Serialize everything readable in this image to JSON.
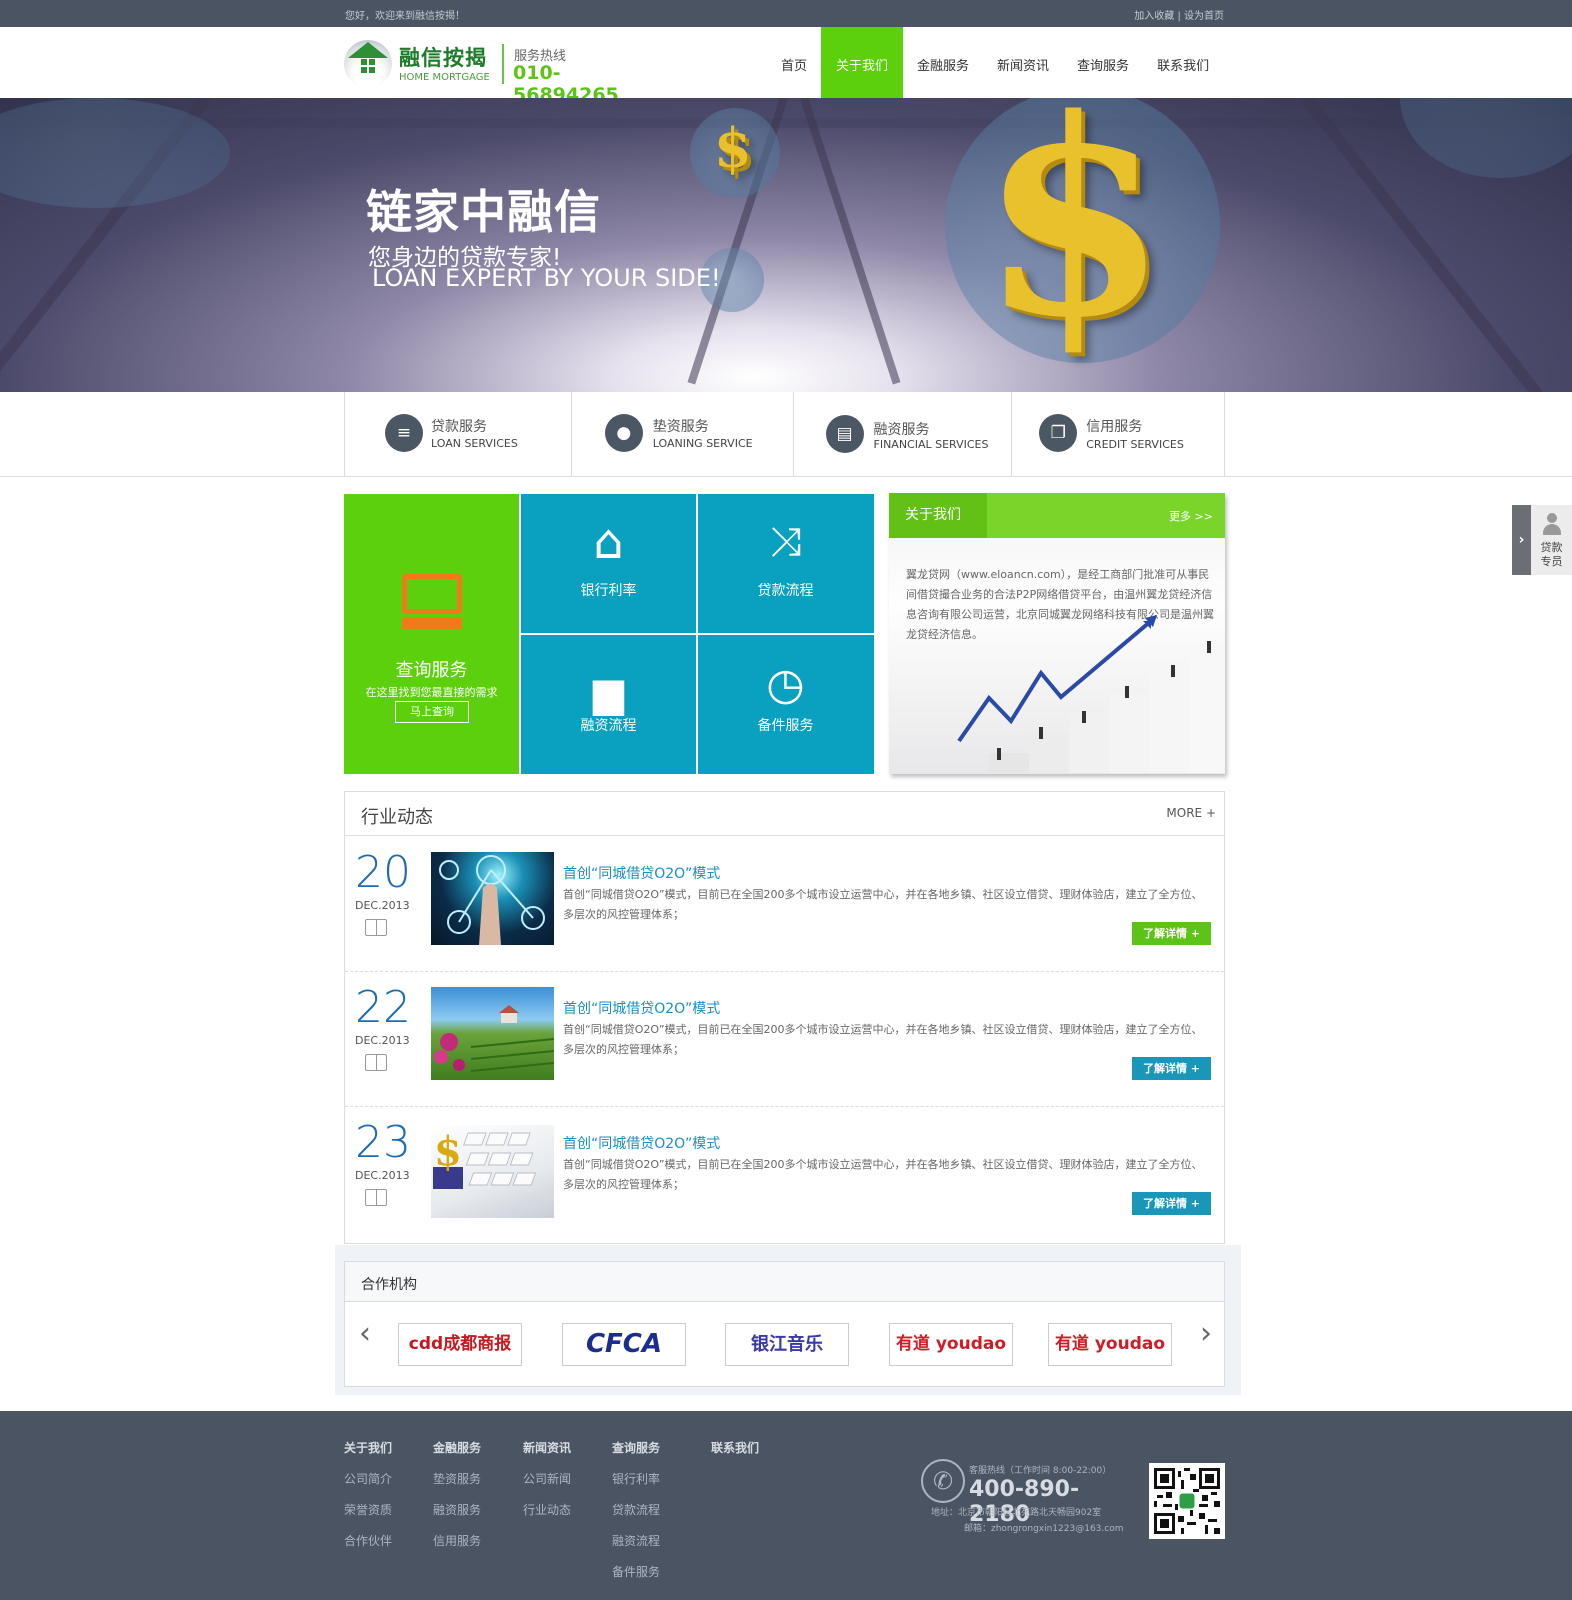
{
  "topbar": {
    "welcome": "您好，欢迎来到融信按揭！",
    "links": "加入收藏 | 设为首页"
  },
  "header": {
    "logo_cn": "融信按揭",
    "logo_en": "HOME MORTGAGE",
    "hotline_label": "服务热线",
    "hotline": "010-56894265"
  },
  "nav": [
    "首页",
    "关于我们",
    "金融服务",
    "新闻资讯",
    "查询服务",
    "联系我们"
  ],
  "nav_active": "关于我们",
  "banner": {
    "title": "链家中融信",
    "subtitle": "您身边的贷款专家!",
    "subtitle_en": "LOAN EXPERT BY YOUR SIDE!",
    "symbol": "$"
  },
  "services": [
    {
      "cn": "贷款服务",
      "en": "LOAN SERVICES",
      "icon": "coins-icon"
    },
    {
      "cn": "垫资服务",
      "en": "LOANING SERVICE",
      "icon": "user-icon"
    },
    {
      "cn": "融资服务",
      "en": "FINANCIAL SERVICES",
      "icon": "briefcase-icon"
    },
    {
      "cn": "信用服务",
      "en": "CREDIT SERVICES",
      "icon": "cards-icon"
    }
  ],
  "query": {
    "title": "查询服务",
    "subtitle": "在这里找到您最直接的需求",
    "button": "马上查询"
  },
  "tiles": [
    {
      "label": "银行利率",
      "icon": "house-icon"
    },
    {
      "label": "贷款流程",
      "icon": "shuffle-icon"
    },
    {
      "label": "融资流程",
      "icon": "bar-chart-icon"
    },
    {
      "label": "备件服务",
      "icon": "clock-icon"
    }
  ],
  "about": {
    "title": "关于我们",
    "more": "更多 >>",
    "text": "翼龙贷网（www.eloancn.com），是经工商部门批准可从事民间借贷撮合业务的合法P2P网络借贷平台，由温州翼龙贷经济信息咨询有限公司运营，北京同城翼龙网络科技有限公司是温州翼龙贷经济信息。"
  },
  "news": {
    "title": "行业动态",
    "more": "MORE +",
    "items": [
      {
        "day": "20",
        "month": "DEC.2013",
        "title": "首创“同城借贷O2O”模式",
        "desc": "首创“同城借贷O2O”模式，目前已在全国200多个城市设立运营中心，并在各地乡镇、社区设立借贷、理财体验店，建立了全方位、多层次的风控管理体系；",
        "button": "了解详情 +",
        "button_color": "#5cc318"
      },
      {
        "day": "22",
        "month": "DEC.2013",
        "title": "首创“同城借贷O2O”模式",
        "desc": "首创“同城借贷O2O”模式，目前已在全国200多个城市设立运营中心，并在各地乡镇、社区设立借贷、理财体验店，建立了全方位、多层次的风控管理体系；",
        "button": "了解详情 +",
        "button_color": "#1a96b8"
      },
      {
        "day": "23",
        "month": "DEC.2013",
        "title": "首创“同城借贷O2O”模式",
        "desc": "首创“同城借贷O2O”模式，目前已在全国200多个城市设立运营中心，并在各地乡镇、社区设立借贷、理财体验店，建立了全方位、多层次的风控管理体系；",
        "button": "了解详情 +",
        "button_color": "#1a96b8"
      }
    ]
  },
  "partners": {
    "title": "合作机构",
    "prev": "‹",
    "next": "›",
    "logos": [
      "cdd成都商报",
      "CFCA",
      "银江音乐",
      "有道 youdao",
      "有道 youdao"
    ]
  },
  "footer": {
    "columns": [
      {
        "head": "关于我们",
        "links": [
          "公司简介",
          "荣誉资质",
          "合作伙伴"
        ]
      },
      {
        "head": "金融服务",
        "links": [
          "垫资服务",
          "融资服务",
          "信用服务"
        ]
      },
      {
        "head": "新闻资讯",
        "links": [
          "公司新闻",
          "行业动态"
        ]
      },
      {
        "head": "查询服务",
        "links": [
          "银行利率",
          "贷款流程",
          "融资流程",
          "备件服务"
        ]
      },
      {
        "head": "联系我们",
        "links": []
      }
    ],
    "hotline_label": "客服热线（工作时间 8:00-22:00）",
    "hotline": "400-890-2180",
    "address": "地址：北京市朝阳区北苑路北天畅园902室",
    "email": "邮箱：zhongrongxin1223@163.com"
  },
  "float": {
    "label1": "贷款",
    "label2": "专员",
    "arrow": "›"
  },
  "colors": {
    "green": "#5cd00c",
    "teal": "#0aa0c0",
    "dark": "#4a5463",
    "link": "#1a8fc4"
  }
}
